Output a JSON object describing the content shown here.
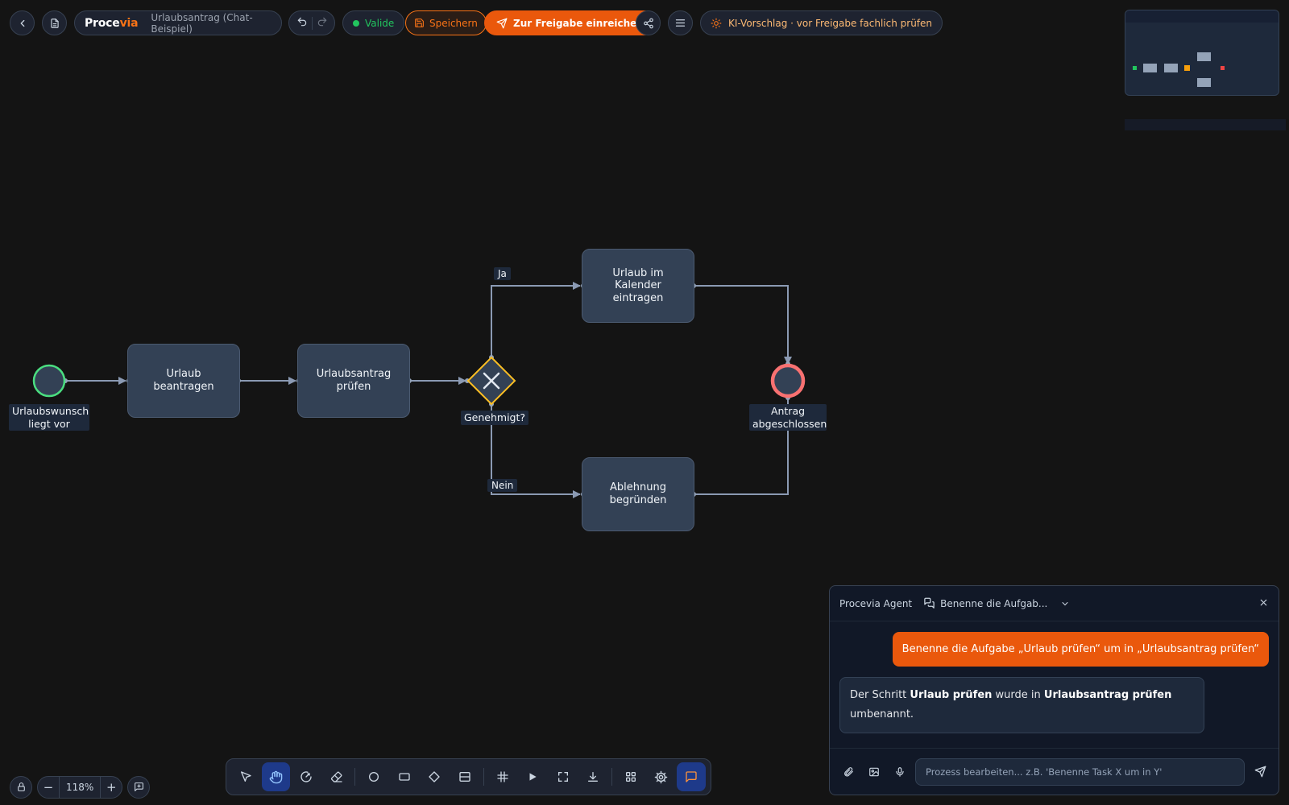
{
  "header": {
    "brand_part1": "Proce",
    "brand_part2": "via",
    "document_title": "Urlaubsantrag (Chat-Beispiel)",
    "valid_label": "Valide",
    "save_label": "Speichern",
    "submit_label": "Zur Freigabe einreichen",
    "ki_notice": "KI-Vorschlag · vor Freigabe fachlich prüfen",
    "colors": {
      "accent": "#ea580c",
      "valid": "#22c55e"
    }
  },
  "diagram": {
    "start_event_label": "Urlaubswunsch liegt vor",
    "tasks": [
      {
        "label": "Urlaub beantragen"
      },
      {
        "label": "Urlaubsantrag prüfen"
      },
      {
        "label": "Urlaub im Kalender eintragen"
      },
      {
        "label": "Ablehnung begründen"
      }
    ],
    "gateway_label": "Genehmigt?",
    "edge_yes": "Ja",
    "edge_no": "Nein",
    "end_event_label": "Antrag abgeschlossen",
    "colors": {
      "start": "#4ade80",
      "end": "#f87171",
      "gateway": "#fbbf24"
    }
  },
  "zoom": {
    "level": "118%",
    "minus": "−",
    "plus": "+"
  },
  "toolbar": {
    "tools": [
      "pointer-icon",
      "hand-icon",
      "lasso-icon",
      "eraser-icon",
      "circle-icon",
      "rectangle-icon",
      "diamond-icon",
      "lane-icon",
      "grid-icon",
      "play-icon",
      "fullscreen-icon",
      "download-icon",
      "apps-icon",
      "settings-icon",
      "chat-icon"
    ]
  },
  "chat": {
    "agent_name": "Procevia Agent",
    "conversation_title": "Benenne die Aufgab...",
    "user_message": "Benenne die Aufgabe „Urlaub prüfen“ um in „Urlaubsantrag prüfen“",
    "bot_message": {
      "part1": "Der Schritt ",
      "bold1": "Urlaub prüfen",
      "part2": " wurde in ",
      "bold2": "Urlaubsantrag prüfen",
      "part3": " umbenannt."
    },
    "input_placeholder": "Prozess bearbeiten... z.B. 'Benenne Task X um in Y'"
  }
}
